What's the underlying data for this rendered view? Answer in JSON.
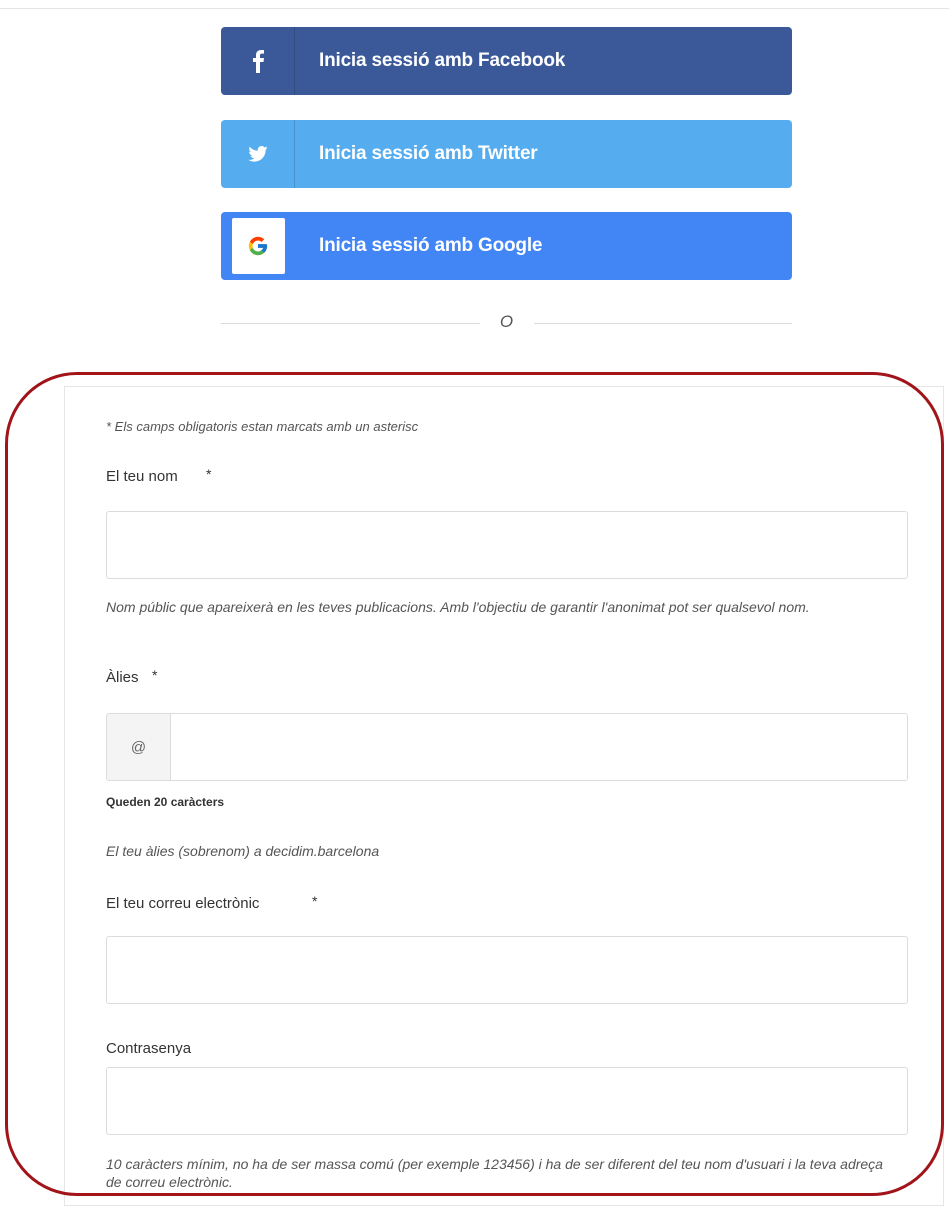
{
  "social": {
    "facebook": {
      "label": "Inicia sessió amb Facebook",
      "icon": "facebook-icon",
      "color": "#3b5998"
    },
    "twitter": {
      "label": "Inicia sessió amb Twitter",
      "icon": "twitter-icon",
      "color": "#55acee"
    },
    "google": {
      "label": "Inicia sessió amb Google",
      "icon": "google-icon",
      "color": "#4285f4"
    }
  },
  "divider": {
    "text": "O"
  },
  "form": {
    "required_note": "* Els camps obligatoris estan marcats amb un asterisc",
    "name": {
      "label": "El teu nom",
      "required_mark": "*",
      "value": "",
      "help": "Nom públic que apareixerà en les teves publicacions. Amb l'objectiu de garantir l'anonimat pot ser qualsevol nom."
    },
    "alias": {
      "label": "Àlies",
      "required_mark": "*",
      "prefix": "@",
      "value": "",
      "counter": "Queden 20 caràcters",
      "help": "El teu àlies (sobrenom) a decidim.barcelona"
    },
    "email": {
      "label": "El teu correu electrònic",
      "required_mark": "*",
      "value": ""
    },
    "password": {
      "label": "Contrasenya",
      "value": "",
      "help": "10 caràcters mínim, no ha de ser massa comú (per exemple 123456) i ha de ser diferent del teu nom d'usuari i la teva adreça de correu electrònic."
    }
  },
  "annotation": {
    "color": "#a0141a"
  }
}
